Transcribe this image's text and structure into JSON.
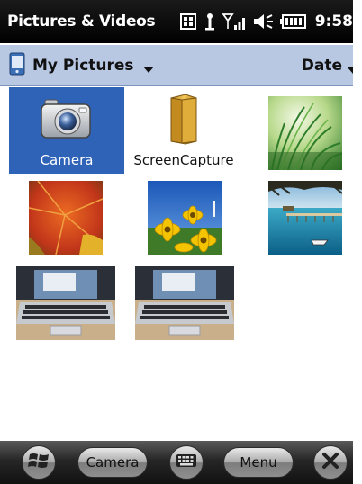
{
  "status_bar": {
    "app_title": "Pictures & Videos",
    "time": "9:58",
    "icons": [
      "windows-flag-icon",
      "antenna-icon",
      "signal-strength-icon",
      "speaker-muted-icon",
      "battery-icon"
    ]
  },
  "folder_bar": {
    "folder_name": "My Pictures",
    "folder_icon": "device-folder-icon",
    "sort_label": "Date"
  },
  "grid": {
    "items": [
      {
        "type": "folder",
        "label": "Camera",
        "icon": "camera-icon",
        "selected": true
      },
      {
        "type": "folder",
        "label": "ScreenCapture",
        "icon": "folder-icon",
        "selected": false
      },
      {
        "type": "photo",
        "subject": "grass"
      },
      {
        "type": "photo",
        "subject": "autumn-leaf"
      },
      {
        "type": "photo",
        "subject": "yellow-flowers"
      },
      {
        "type": "photo",
        "subject": "tropical-pier"
      },
      {
        "type": "photo",
        "subject": "laptop-keyboard"
      },
      {
        "type": "photo",
        "subject": "laptop-keyboard"
      }
    ]
  },
  "softkeys": {
    "start_icon": "windows-logo-icon",
    "left_label": "Camera",
    "keyboard_icon": "keyboard-icon",
    "right_label": "Menu",
    "close_icon": "close-icon"
  },
  "colors": {
    "titlebar": "#000000",
    "folderbar": "#b8c7e2",
    "selection": "#2f63b8"
  }
}
